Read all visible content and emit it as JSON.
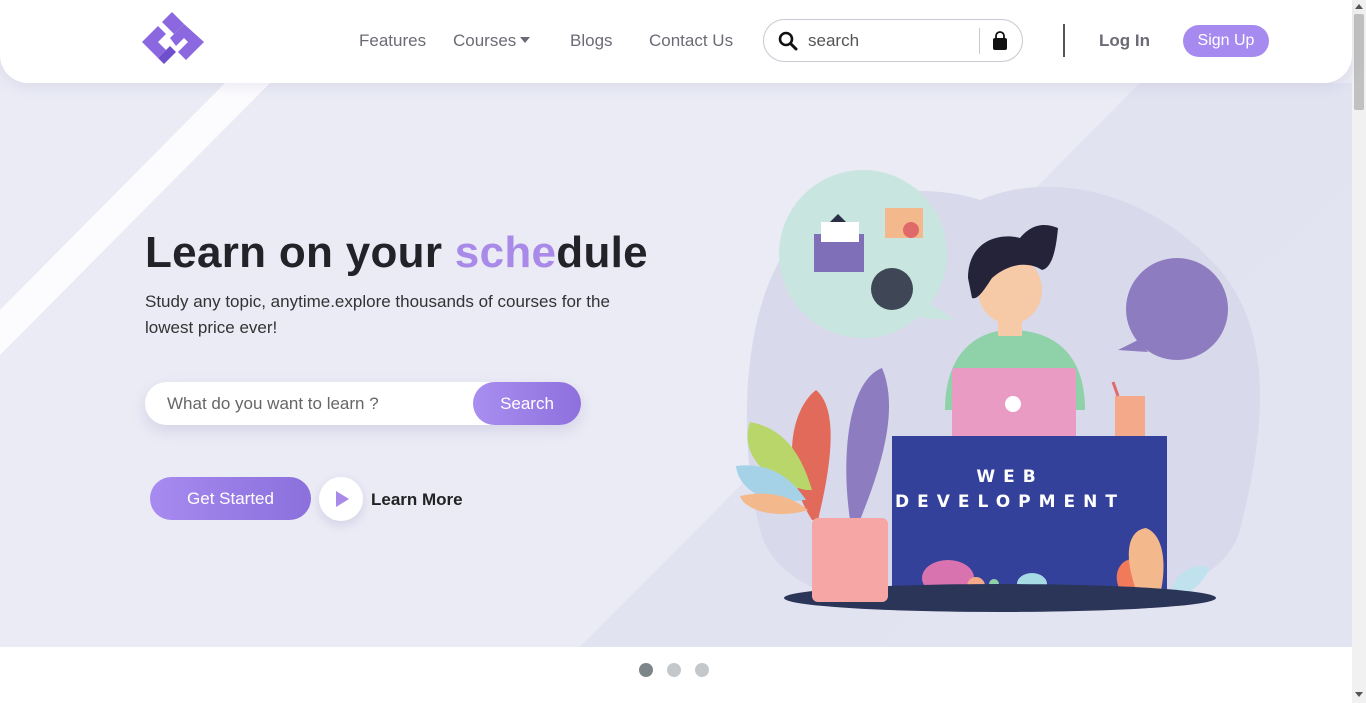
{
  "nav": {
    "logo_icon": "brand-logo-icon",
    "links": [
      "Features",
      "Courses",
      "Blogs",
      "Contact Us"
    ],
    "search_placeholder": "search",
    "login": "Log In",
    "signup": "Sign Up"
  },
  "hero": {
    "headline_part1": "Learn on your ",
    "headline_accent": "sche",
    "headline_part2": "dule",
    "subtext": "Study any topic, anytime.explore thousands of courses for the lowest price ever!",
    "learn_placeholder": "What do you want to learn ?",
    "search_button": "Search",
    "get_started": "Get Started",
    "learn_more": "Learn More",
    "illustration_line1": "WEB",
    "illustration_line2": "DEVELOPMENT"
  },
  "carousel": {
    "slide_count": 3,
    "active_index": 0
  },
  "colors": {
    "accent": "#a98ae8",
    "button_gradient_start": "#a78bf0",
    "button_gradient_end": "#8b6fdc",
    "hero_bg": "#eaebf5",
    "desk_blue": "#34419b"
  },
  "icons": {
    "search": "search-icon",
    "cart": "shopping-bag-icon",
    "play": "play-icon"
  }
}
